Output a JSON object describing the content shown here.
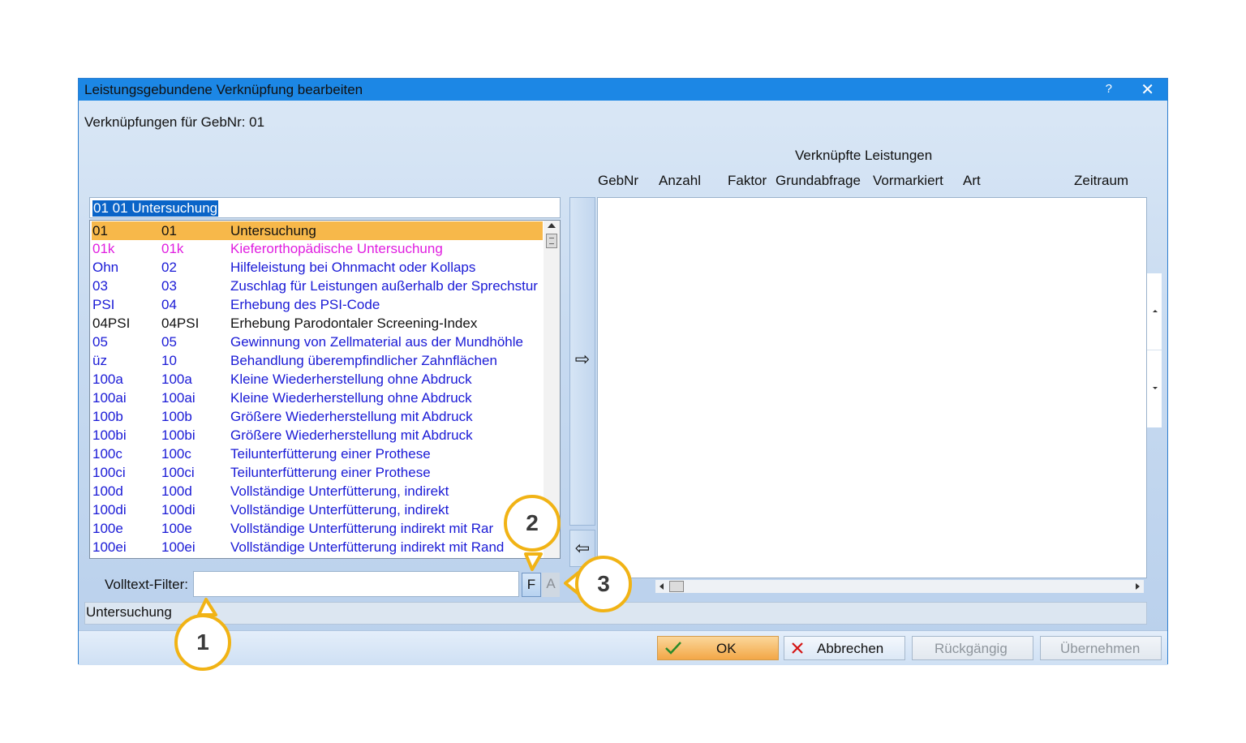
{
  "window": {
    "title": "Leistungsgebundene Verknüpfung bearbeiten",
    "help_label": "?",
    "close_label": "✕"
  },
  "subtitle": "Verknüpfungen für GebNr: 01",
  "linked": {
    "group_title": "Verknüpfte Leistungen",
    "columns": [
      "GebNr",
      "Anzahl",
      "Faktor",
      "Grundabfrage",
      "Vormarkiert",
      "Art",
      "Zeitraum"
    ]
  },
  "selection_header": "01 01 Untersuchung",
  "services": [
    {
      "code": "01",
      "nr": "01",
      "desc": "Untersuchung",
      "color": "black",
      "selected": true
    },
    {
      "code": "01k",
      "nr": "01k",
      "desc": "Kieferorthopädische Untersuchung",
      "color": "magenta"
    },
    {
      "code": "Ohn",
      "nr": "02",
      "desc": "Hilfeleistung bei Ohnmacht oder Kollaps",
      "color": "blue"
    },
    {
      "code": "03",
      "nr": "03",
      "desc": "Zuschlag für Leistungen außerhalb der Sprechstur",
      "color": "blue"
    },
    {
      "code": "PSI",
      "nr": "04",
      "desc": "Erhebung des PSI-Code",
      "color": "blue"
    },
    {
      "code": "04PSI",
      "nr": "04PSI",
      "desc": "Erhebung Parodontaler Screening-Index",
      "color": "black"
    },
    {
      "code": "05",
      "nr": "05",
      "desc": "Gewinnung von Zellmaterial aus der Mundhöhle",
      "color": "blue"
    },
    {
      "code": "üz",
      "nr": "10",
      "desc": "Behandlung überempfindlicher Zahnflächen",
      "color": "blue"
    },
    {
      "code": "100a",
      "nr": "100a",
      "desc": "Kleine Wiederherstellung ohne Abdruck",
      "color": "blue"
    },
    {
      "code": "100ai",
      "nr": "100ai",
      "desc": "Kleine Wiederherstellung ohne Abdruck",
      "color": "blue"
    },
    {
      "code": "100b",
      "nr": "100b",
      "desc": "Größere Wiederherstellung mit Abdruck",
      "color": "blue"
    },
    {
      "code": "100bi",
      "nr": "100bi",
      "desc": "Größere Wiederherstellung mit Abdruck",
      "color": "blue"
    },
    {
      "code": "100c",
      "nr": "100c",
      "desc": "Teilunterfütterung einer Prothese",
      "color": "blue"
    },
    {
      "code": "100ci",
      "nr": "100ci",
      "desc": "Teilunterfütterung einer Prothese",
      "color": "blue"
    },
    {
      "code": "100d",
      "nr": "100d",
      "desc": "Vollständige Unterfütterung, indirekt",
      "color": "blue"
    },
    {
      "code": "100di",
      "nr": "100di",
      "desc": "Vollständige Unterfütterung, indirekt",
      "color": "blue"
    },
    {
      "code": "100e",
      "nr": "100e",
      "desc": "Vollständige Unterfütterung indirekt mit Rar",
      "color": "blue"
    },
    {
      "code": "100ei",
      "nr": "100ei",
      "desc": "Vollständige Unterfütterung indirekt mit Rand",
      "color": "blue"
    }
  ],
  "arrows": {
    "add": "⇨",
    "remove": "⇦"
  },
  "filter": {
    "label": "Volltext-Filter:",
    "value": "",
    "btn_f": "F",
    "btn_a": "A"
  },
  "status_text": "Untersuchung",
  "buttons": {
    "ok": "OK",
    "cancel": "Abbrechen",
    "undo": "Rückgängig",
    "apply": "Übernehmen"
  },
  "callouts": [
    "1",
    "2",
    "3"
  ],
  "colors": {
    "title_bar": "#1c87e5",
    "selection": "#f7b84a",
    "link_blue": "#1a1ad6",
    "magenta": "#e01ee0",
    "callout": "#f1b315"
  }
}
